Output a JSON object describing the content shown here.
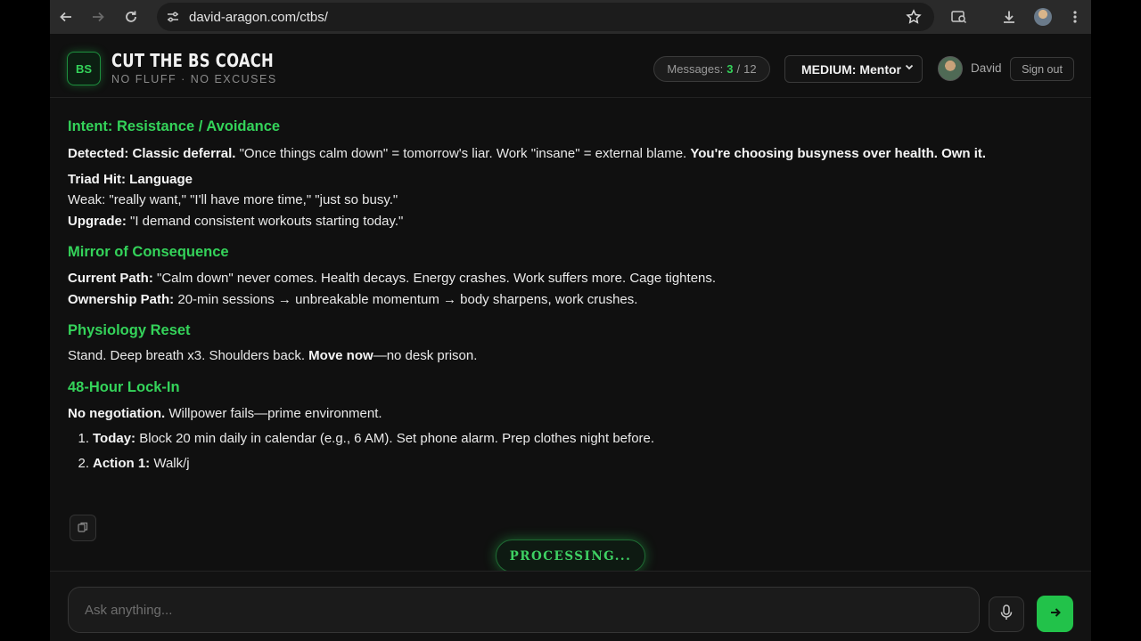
{
  "browser": {
    "url": "david-aragon.com/ctbs/"
  },
  "header": {
    "logo_text": "BS",
    "title": "CUT THE BS COACH",
    "subtitle": "NO FLUFF · NO EXCUSES",
    "messages_label": "Messages:",
    "messages_used": "3",
    "messages_sep": "/",
    "messages_total": "12",
    "mode_value": "MEDIUM: Mentor",
    "user_name": "David",
    "signout_label": "Sign out"
  },
  "message": {
    "intent_heading": "Intent: Resistance / Avoidance",
    "detected_label": "Detected:",
    "detected_bold": "Classic deferral.",
    "detected_text": " \"Once things calm down\" = tomorrow's liar. Work \"insane\" = external blame. ",
    "detected_bold2": "You're choosing busyness over health. Own it.",
    "triad_label": "Triad Hit: Language",
    "weak_text": "Weak: \"really want,\" \"I'll have more time,\" \"just so busy.\"",
    "upgrade_label": "Upgrade:",
    "upgrade_text": " \"I demand consistent workouts starting today.\"",
    "mirror_heading": "Mirror of Consequence",
    "current_label": "Current Path:",
    "current_text": " \"Calm down\" never comes. Health decays. Energy crashes. Work suffers more. Cage tightens.",
    "ownership_label": "Ownership Path:",
    "ownership_text": " 20-min sessions → unbreakable momentum → body sharpens, work crushes.",
    "physio_heading": "Physiology Reset",
    "physio_text1": "Stand. Deep breath x3. Shoulders back. ",
    "physio_bold": "Move now",
    "physio_text2": "—no desk prison.",
    "lockin_heading": "48-Hour Lock-In",
    "lockin_bold": "No negotiation.",
    "lockin_text": " Willpower fails—prime environment.",
    "list": [
      {
        "num": "1.",
        "label": "Today:",
        "text": " Block 20 min daily in calendar (e.g., 6 AM). Set phone alarm. Prep clothes night before."
      },
      {
        "num": "2.",
        "label": "Action 1:",
        "text": " Walk/j"
      }
    ]
  },
  "status": {
    "processing": "PROCESSING..."
  },
  "composer": {
    "placeholder": "Ask anything..."
  },
  "colors": {
    "accent": "#34d35a",
    "background": "#101010"
  }
}
